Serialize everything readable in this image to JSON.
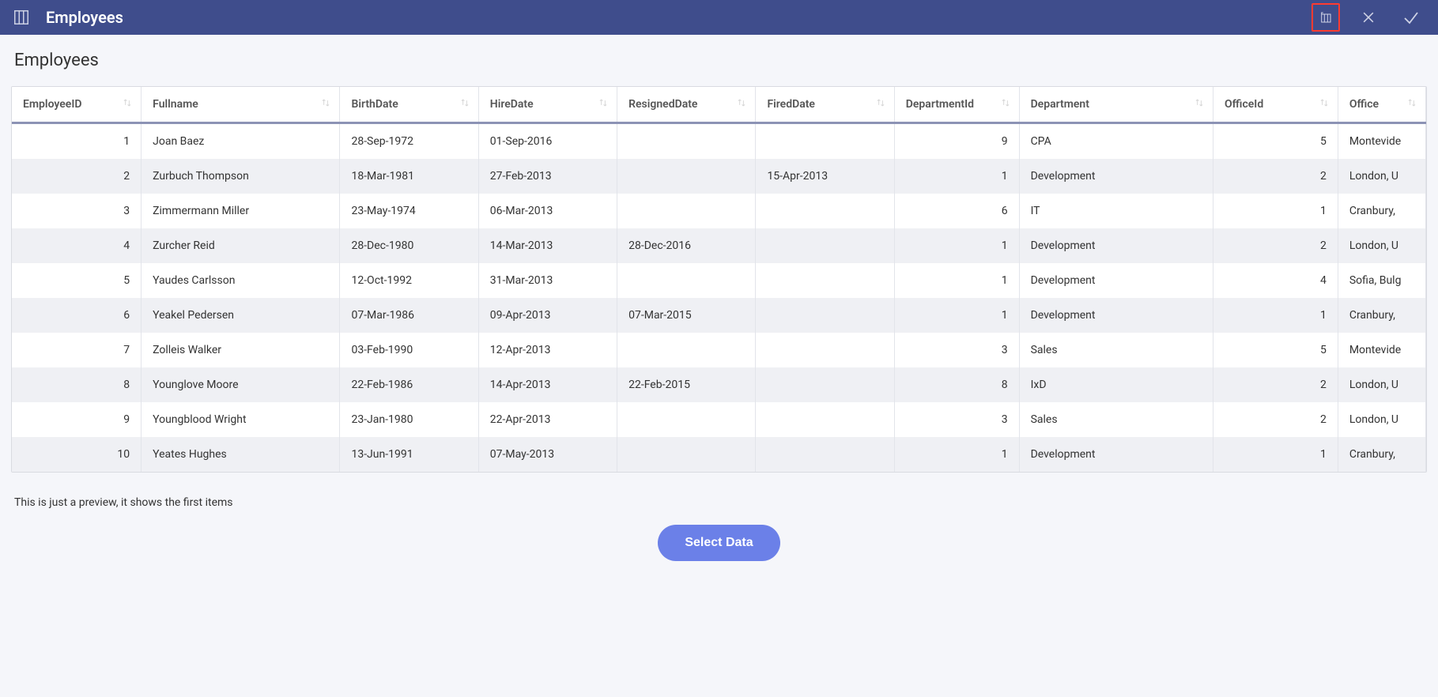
{
  "header": {
    "title": "Employees"
  },
  "page": {
    "title": "Employees",
    "preview_note": "This is just a preview, it shows the first items",
    "select_button": "Select Data"
  },
  "table": {
    "columns": [
      {
        "key": "EmployeeID",
        "label": "EmployeeID",
        "align": "right"
      },
      {
        "key": "Fullname",
        "label": "Fullname",
        "align": "left"
      },
      {
        "key": "BirthDate",
        "label": "BirthDate",
        "align": "left"
      },
      {
        "key": "HireDate",
        "label": "HireDate",
        "align": "left"
      },
      {
        "key": "ResignedDate",
        "label": "ResignedDate",
        "align": "left"
      },
      {
        "key": "FiredDate",
        "label": "FiredDate",
        "align": "left"
      },
      {
        "key": "DepartmentId",
        "label": "DepartmentId",
        "align": "right"
      },
      {
        "key": "Department",
        "label": "Department",
        "align": "left"
      },
      {
        "key": "OfficeId",
        "label": "OfficeId",
        "align": "right"
      },
      {
        "key": "Office",
        "label": "Office",
        "align": "left"
      }
    ],
    "rows": [
      {
        "EmployeeID": "1",
        "Fullname": "Joan Baez",
        "BirthDate": "28-Sep-1972",
        "HireDate": "01-Sep-2016",
        "ResignedDate": "",
        "FiredDate": "",
        "DepartmentId": "9",
        "Department": "CPA",
        "OfficeId": "5",
        "Office": "Montevide"
      },
      {
        "EmployeeID": "2",
        "Fullname": "Zurbuch Thompson",
        "BirthDate": "18-Mar-1981",
        "HireDate": "27-Feb-2013",
        "ResignedDate": "",
        "FiredDate": "15-Apr-2013",
        "DepartmentId": "1",
        "Department": "Development",
        "OfficeId": "2",
        "Office": "London, U"
      },
      {
        "EmployeeID": "3",
        "Fullname": "Zimmermann Miller",
        "BirthDate": "23-May-1974",
        "HireDate": "06-Mar-2013",
        "ResignedDate": "",
        "FiredDate": "",
        "DepartmentId": "6",
        "Department": "IT",
        "OfficeId": "1",
        "Office": "Cranbury, "
      },
      {
        "EmployeeID": "4",
        "Fullname": "Zurcher Reid",
        "BirthDate": "28-Dec-1980",
        "HireDate": "14-Mar-2013",
        "ResignedDate": "28-Dec-2016",
        "FiredDate": "",
        "DepartmentId": "1",
        "Department": "Development",
        "OfficeId": "2",
        "Office": "London, U"
      },
      {
        "EmployeeID": "5",
        "Fullname": "Yaudes Carlsson",
        "BirthDate": "12-Oct-1992",
        "HireDate": "31-Mar-2013",
        "ResignedDate": "",
        "FiredDate": "",
        "DepartmentId": "1",
        "Department": "Development",
        "OfficeId": "4",
        "Office": "Sofia, Bulg"
      },
      {
        "EmployeeID": "6",
        "Fullname": "Yeakel Pedersen",
        "BirthDate": "07-Mar-1986",
        "HireDate": "09-Apr-2013",
        "ResignedDate": "07-Mar-2015",
        "FiredDate": "",
        "DepartmentId": "1",
        "Department": "Development",
        "OfficeId": "1",
        "Office": "Cranbury, "
      },
      {
        "EmployeeID": "7",
        "Fullname": "Zolleis Walker",
        "BirthDate": "03-Feb-1990",
        "HireDate": "12-Apr-2013",
        "ResignedDate": "",
        "FiredDate": "",
        "DepartmentId": "3",
        "Department": "Sales",
        "OfficeId": "5",
        "Office": "Montevide"
      },
      {
        "EmployeeID": "8",
        "Fullname": "Younglove Moore",
        "BirthDate": "22-Feb-1986",
        "HireDate": "14-Apr-2013",
        "ResignedDate": "22-Feb-2015",
        "FiredDate": "",
        "DepartmentId": "8",
        "Department": "IxD",
        "OfficeId": "2",
        "Office": "London, U"
      },
      {
        "EmployeeID": "9",
        "Fullname": "Youngblood Wright",
        "BirthDate": "23-Jan-1980",
        "HireDate": "22-Apr-2013",
        "ResignedDate": "",
        "FiredDate": "",
        "DepartmentId": "3",
        "Department": "Sales",
        "OfficeId": "2",
        "Office": "London, U"
      },
      {
        "EmployeeID": "10",
        "Fullname": "Yeates Hughes",
        "BirthDate": "13-Jun-1991",
        "HireDate": "07-May-2013",
        "ResignedDate": "",
        "FiredDate": "",
        "DepartmentId": "1",
        "Department": "Development",
        "OfficeId": "1",
        "Office": "Cranbury, "
      }
    ]
  }
}
